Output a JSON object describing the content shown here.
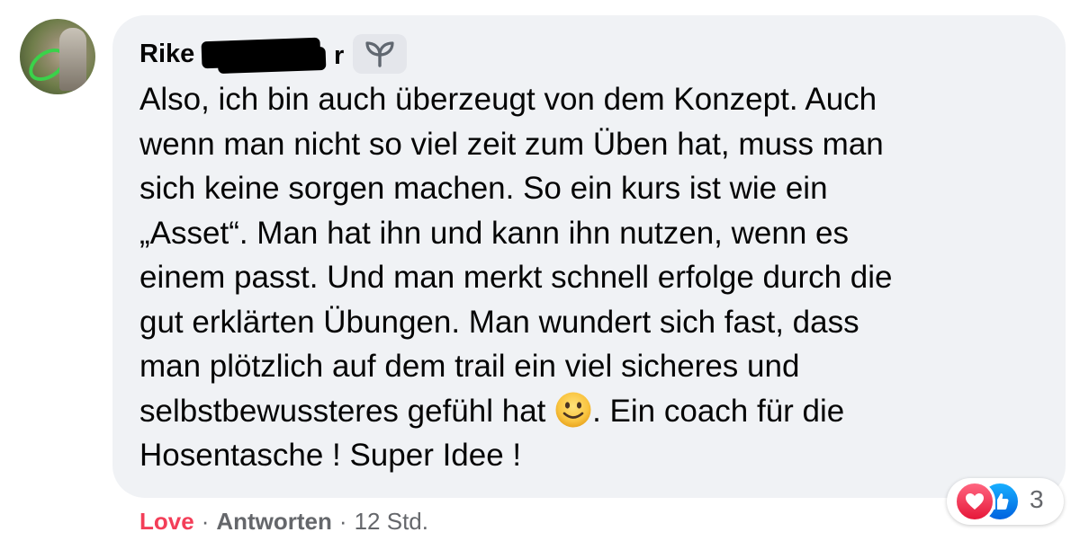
{
  "comment": {
    "author_name": "Rike",
    "author_name_tail": "r",
    "text_before_emoji": "Also, ich bin auch überzeugt von dem Konzept. Auch\nwenn man nicht so viel zeit zum Üben hat, muss man\nsich keine sorgen machen. So ein kurs ist wie ein\n„Asset“. Man hat ihn und kann ihn nutzen, wenn es\neinem passt. Und man merkt schnell erfolge durch die\ngut erklärten Übungen. Man wundert sich fast, dass\nman plötzlich auf dem trail ein viel sicheres und\nselbstbewussteres gefühl hat ",
    "emoji_icon": "slightly-smiling-face-icon",
    "text_after_emoji": ". Ein coach für die\nHosentasche ! Super Idee !",
    "badge_icon": "sprout-icon"
  },
  "actions": {
    "love_label": "Love",
    "separator": "·",
    "reply_label": "Antworten",
    "timestamp": "12 Std."
  },
  "reactions": {
    "icons": [
      "heart-icon",
      "thumbs-up-icon"
    ],
    "count": "3"
  },
  "colors": {
    "bubble_bg": "#f0f2f5",
    "love": "#f33e58",
    "meta_text": "#65676b",
    "heart": "#f33e58",
    "like": "#1877f2"
  }
}
